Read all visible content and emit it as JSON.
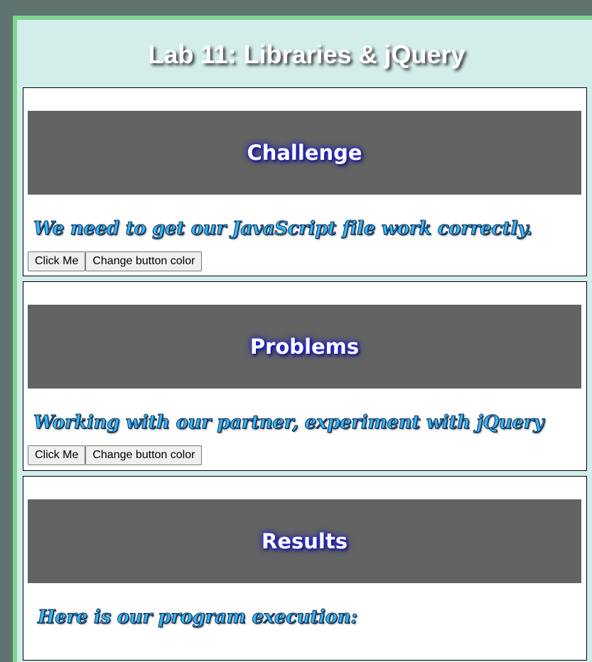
{
  "page": {
    "title": "Lab 11: Libraries & jQuery"
  },
  "sections": [
    {
      "heading": "Challenge",
      "text": "We need to get our JavaScript file work correctly.",
      "buttons": {
        "click": "Click Me",
        "color": "Change button color"
      }
    },
    {
      "heading": "Problems",
      "text": "Working with our partner, experiment with jQuery",
      "buttons": {
        "click": "Click Me",
        "color": "Change button color"
      }
    },
    {
      "heading": "Results",
      "text": "Here is our program execution:"
    }
  ],
  "colors": {
    "background": "#5f7471",
    "page": "#d3eeea",
    "page_border": "#7fd68f",
    "banner": "#636363",
    "text_fill": "#3bb6f2"
  }
}
